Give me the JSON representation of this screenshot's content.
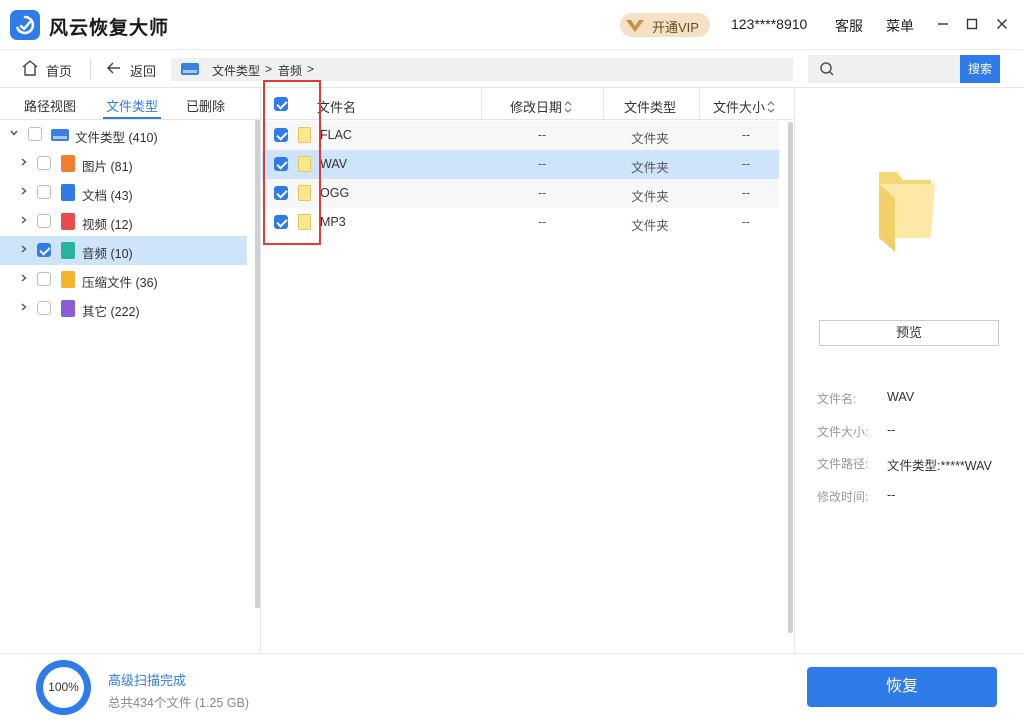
{
  "app": {
    "name": "风云恢复大师"
  },
  "titlebar": {
    "vip_label": "开通VIP",
    "phone": "123****8910",
    "service": "客服",
    "menu": "菜单"
  },
  "nav": {
    "home": "首页",
    "back": "返回",
    "breadcrumb": [
      "文件类型",
      ">",
      "音频",
      ">"
    ],
    "search_button": "搜索",
    "search_placeholder": ""
  },
  "left_tabs": [
    "路径视图",
    "文件类型",
    "已删除"
  ],
  "tree": {
    "root": "文件类型 (410)",
    "items": [
      {
        "label": "图片 (81)",
        "icon": "image-icon",
        "color": "#f07e2e",
        "checked": false,
        "selected": false
      },
      {
        "label": "文档 (43)",
        "icon": "document-icon",
        "color": "#2f7be8",
        "checked": false,
        "selected": false
      },
      {
        "label": "视频 (12)",
        "icon": "video-icon",
        "color": "#e94b4b",
        "checked": false,
        "selected": false
      },
      {
        "label": "音频 (10)",
        "icon": "audio-icon",
        "color": "#28b39a",
        "checked": true,
        "selected": true
      },
      {
        "label": "压缩文件 (36)",
        "icon": "archive-icon",
        "color": "#f3b42b",
        "checked": false,
        "selected": false
      },
      {
        "label": "其它 (222)",
        "icon": "other-icon",
        "color": "#8b5cd6",
        "checked": false,
        "selected": false
      }
    ]
  },
  "columns": [
    "文件名",
    "修改日期",
    "文件类型",
    "文件大小"
  ],
  "files": [
    {
      "name": "FLAC",
      "date": "--",
      "type": "文件夹",
      "size": "--",
      "checked": true
    },
    {
      "name": "WAV",
      "date": "--",
      "type": "文件夹",
      "size": "--",
      "checked": true
    },
    {
      "name": "OGG",
      "date": "--",
      "type": "文件夹",
      "size": "--",
      "checked": true
    },
    {
      "name": "MP3",
      "date": "--",
      "type": "文件夹",
      "size": "--",
      "checked": true
    }
  ],
  "preview": {
    "button": "预览",
    "props": [
      {
        "k": "文件名:",
        "v": "WAV"
      },
      {
        "k": "文件大小:",
        "v": "--"
      },
      {
        "k": "文件路径:",
        "v": "文件类型:*****WAV"
      },
      {
        "k": "修改时间:",
        "v": "--"
      }
    ]
  },
  "status": {
    "progress": "100%",
    "title": "高级扫描完成",
    "subtitle": "总共434个文件 (1.25 GB)",
    "recover": "恢复"
  },
  "colors": {
    "accent": "#2f7be8",
    "selection": "#cde4fb",
    "highlight": "#e53935"
  }
}
